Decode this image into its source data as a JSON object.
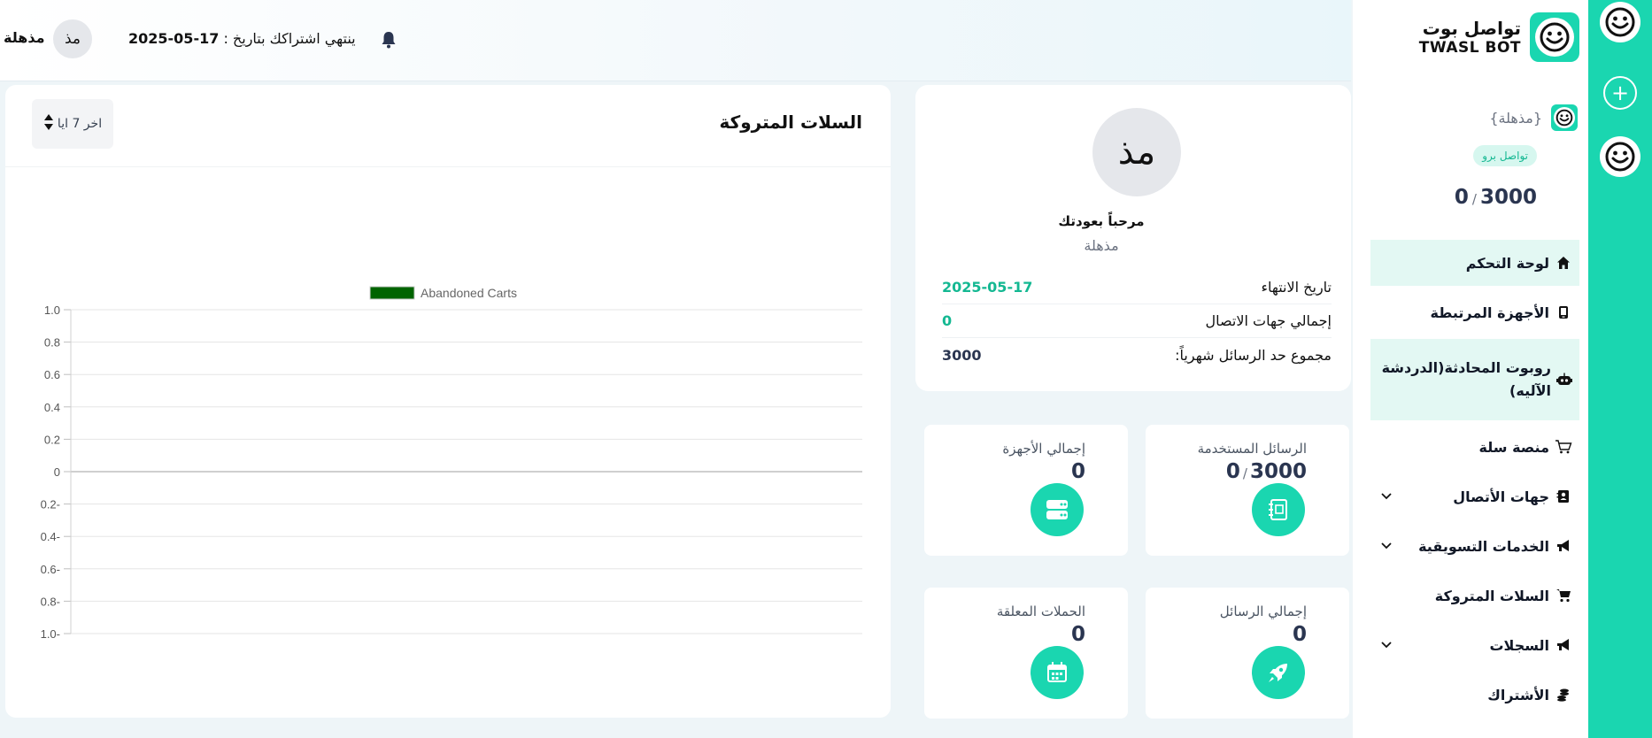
{
  "colors": {
    "accent": "#1ad6b0",
    "accent_text": "#14b892",
    "dark": "#2a3550",
    "chart_series": "#006400"
  },
  "header": {
    "avatar_text": "مذ",
    "username": "مذهلة",
    "subscription_prefix": "ينتهي اشتراكك بتاريخ :",
    "subscription_date": "17-05-2025",
    "bell_icon": "bell-icon"
  },
  "brand": {
    "name_ar": "تواصل بوت",
    "name_en": "TWASL BOT"
  },
  "sidebar": {
    "user_name": "{مذهلة}",
    "plan_badge": "تواصل برو",
    "quota_used": "0",
    "quota_sep": "/",
    "quota_total": "3000",
    "items": [
      {
        "label": "لوحة التحكم",
        "icon": "home-icon",
        "active": true
      },
      {
        "label": "الأجهزة المرتبطة",
        "icon": "device-icon"
      },
      {
        "label": "روبوت المحادثة(الدردشة الآليه)",
        "icon": "robot-icon",
        "active": true
      },
      {
        "label": "منصة سلة",
        "icon": "cart-outline-icon"
      },
      {
        "label": "جهات الأتصال",
        "icon": "contacts-icon",
        "chevron": true
      },
      {
        "label": "الخدمات التسويقية",
        "icon": "megaphone-icon",
        "chevron": true
      },
      {
        "label": "السلات المتروكة",
        "icon": "cart-icon"
      },
      {
        "label": "السجلات",
        "icon": "megaphone-icon",
        "chevron": true
      },
      {
        "label": "الأشتراك",
        "icon": "coins-icon"
      }
    ]
  },
  "profile": {
    "avatar_text": "مذ",
    "welcome": "مرحباً بعودتك",
    "name": "مذهلة",
    "rows": [
      {
        "label": "تاريخ الانتهاء",
        "value": "2025-05-17"
      },
      {
        "label": "إجمالي جهات الاتصال",
        "value": "0"
      },
      {
        "label": "مجموع حد الرسائل شهرياً:",
        "value": "3000"
      }
    ]
  },
  "stats": {
    "used_messages": {
      "label": "الرسائل المستخدمة",
      "value": "0",
      "sep": "/",
      "total": "3000"
    },
    "total_devices": {
      "label": "إجمالي الأجهزة",
      "value": "0"
    },
    "total_messages": {
      "label": "إجمالي الرسائل",
      "value": "0"
    },
    "pending_campaigns": {
      "label": "الحملات المعلقة",
      "value": "0"
    }
  },
  "chart_card": {
    "title": "السلات المتروكة",
    "range_label": "اخر 7 ايا"
  },
  "chart_data": {
    "type": "line",
    "legend": [
      "Abandoned Carts"
    ],
    "legend_position": "top-center",
    "grid": true,
    "ylim": [
      -1.0,
      1.0
    ],
    "y_ticks": [
      "1.0",
      "0.8",
      "0.6",
      "0.4",
      "0.2",
      "0",
      "0.2-",
      "0.4-",
      "0.6-",
      "0.8-",
      "1.0-"
    ],
    "x": [],
    "series": [
      {
        "name": "Abandoned Carts",
        "values": []
      }
    ]
  }
}
